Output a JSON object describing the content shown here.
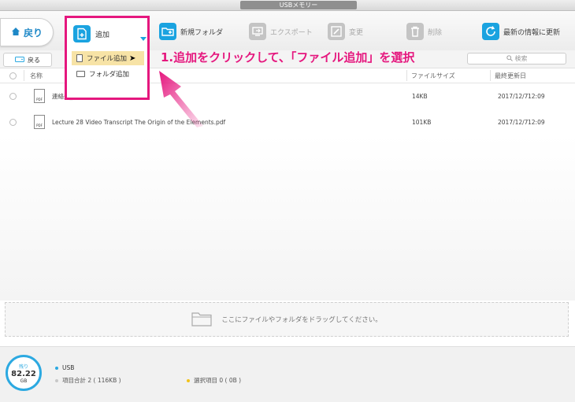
{
  "window": {
    "title": "USBメモリー"
  },
  "toolbar": {
    "back_label": "戻り",
    "add_label": "追加",
    "new_folder_label": "新規フォルダ",
    "export_label": "エクスポート",
    "edit_label": "変更",
    "delete_label": "削除",
    "refresh_label": "最新の情報に更新",
    "accent": "#1aa3e0"
  },
  "add_menu": {
    "items": [
      {
        "label": "ファイル追加",
        "icon": "document-icon",
        "selected": true
      },
      {
        "label": "フォルダ追加",
        "icon": "folder-icon",
        "selected": false
      }
    ]
  },
  "annotation": {
    "text": "1.追加をクリックして、「ファイル追加」を選択",
    "color": "#e5177e"
  },
  "subbar": {
    "back_label": "戻る",
    "search_placeholder": "検索"
  },
  "table": {
    "columns": {
      "name": "名称",
      "size": "ファイルサイズ",
      "modified": "最終更新日"
    },
    "rows": [
      {
        "name": "連絡先_1.pdf",
        "size": "14KB",
        "date": "2017/12/7",
        "time": "12:09"
      },
      {
        "name": "Lecture 28 Video Transcript The Origin of the Elements.pdf",
        "size": "101KB",
        "date": "2017/12/7",
        "time": "12:09"
      }
    ],
    "file_badge": "PDF"
  },
  "dropzone": {
    "text": "ここにファイルやフォルダをドラッグしてください。"
  },
  "status": {
    "gauge_label": "残り",
    "gauge_value": "82.22",
    "gauge_unit": "GB",
    "device": "USB",
    "total_label": "項目合計 2 ( 116KB )",
    "selected_label": "選択項目 0 ( 0B )"
  }
}
